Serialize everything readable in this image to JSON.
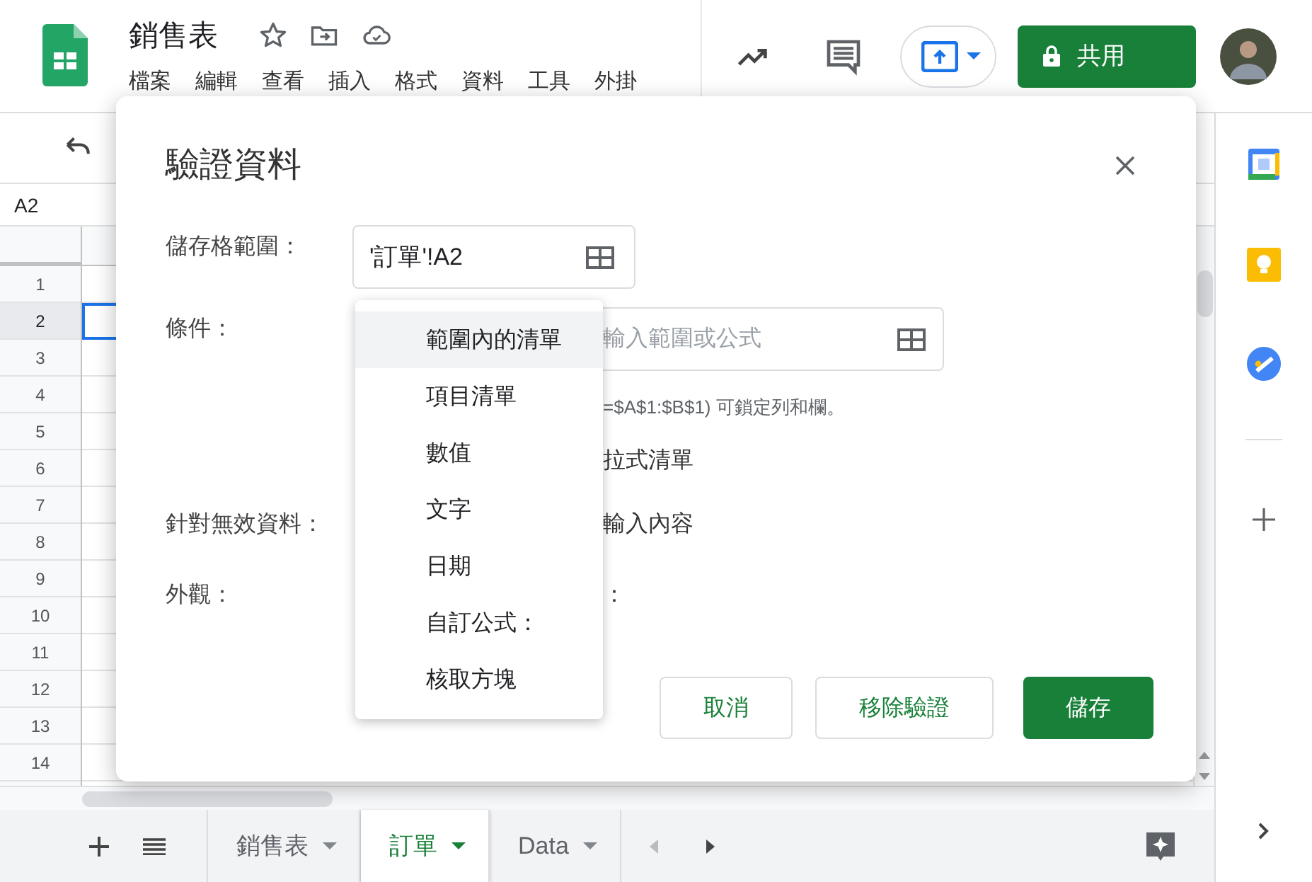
{
  "app": {
    "doc_title": "銷售表",
    "menu": [
      "檔案",
      "編輯",
      "查看",
      "插入",
      "格式",
      "資料",
      "工具",
      "外掛"
    ],
    "share_label": "共用"
  },
  "name_box": "A2",
  "rows": [
    {
      "label": "1",
      "selected": false
    },
    {
      "label": "2",
      "selected": true
    },
    {
      "label": "3",
      "selected": false
    },
    {
      "label": "4",
      "selected": false
    },
    {
      "label": "5",
      "selected": false
    },
    {
      "label": "6",
      "selected": false
    },
    {
      "label": "7",
      "selected": false
    },
    {
      "label": "8",
      "selected": false
    },
    {
      "label": "9",
      "selected": false
    },
    {
      "label": "10",
      "selected": false
    },
    {
      "label": "11",
      "selected": false
    },
    {
      "label": "12",
      "selected": false
    },
    {
      "label": "13",
      "selected": false
    },
    {
      "label": "14",
      "selected": false
    }
  ],
  "dialog": {
    "title": "驗證資料",
    "range_label": "儲存格範圍：",
    "range_value": "'訂單'!A2",
    "criteria_label": "條件：",
    "criteria_placeholder": "輸入範圍或公式",
    "criteria_hint": "=$A$1:$B$1) 可鎖定列和欄。",
    "dropdown_option": "拉式清單",
    "invalid_label": "針對無效資料：",
    "invalid_option": "輸入內容",
    "appearance_label": "外觀：",
    "appearance_tail": "：",
    "buttons": [
      {
        "label": "取消",
        "kind": "secondary"
      },
      {
        "label": "移除驗證",
        "kind": "secondary"
      },
      {
        "label": "儲存",
        "kind": "primary"
      }
    ]
  },
  "criteria_menu": [
    {
      "label": "範圍內的清單",
      "selected": true
    },
    {
      "label": "項目清單",
      "selected": false
    },
    {
      "label": "數值",
      "selected": false
    },
    {
      "label": "文字",
      "selected": false
    },
    {
      "label": "日期",
      "selected": false
    },
    {
      "label": "自訂公式：",
      "selected": false
    },
    {
      "label": "核取方塊",
      "selected": false
    }
  ],
  "sheet_tabs": [
    {
      "label": "銷售表",
      "selected": false
    },
    {
      "label": "訂單",
      "selected": true
    },
    {
      "label": "Data",
      "selected": false
    }
  ]
}
